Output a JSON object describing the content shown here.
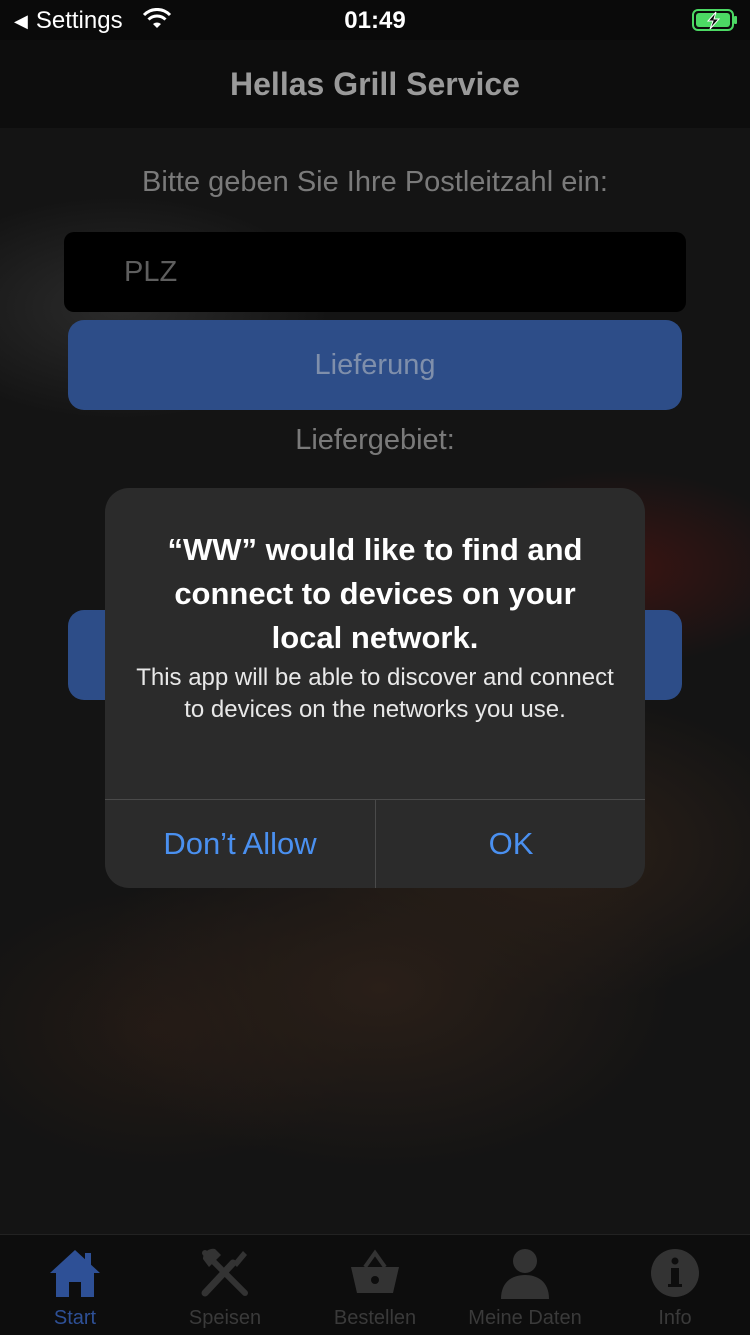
{
  "status_bar": {
    "back_label": "Settings",
    "time": "01:49"
  },
  "nav": {
    "title": "Hellas Grill Service"
  },
  "main": {
    "prompt": "Bitte geben Sie Ihre Postleitzahl ein:",
    "plz_placeholder": "PLZ",
    "delivery_button": "Lieferung",
    "delivery_area_label": "Liefergebiet:"
  },
  "alert": {
    "title": "“WW” would like to find and connect to devices on your local network.",
    "message": "This app will be able to discover and connect to devices on the networks you use.",
    "deny_label": "Don’t Allow",
    "ok_label": "OK",
    "button_color": "#4a90f0"
  },
  "tabs": [
    {
      "label": "Start",
      "icon": "home-icon",
      "active": true
    },
    {
      "label": "Speisen",
      "icon": "fork-knife-icon",
      "active": false
    },
    {
      "label": "Bestellen",
      "icon": "basket-icon",
      "active": false
    },
    {
      "label": "Meine Daten",
      "icon": "person-icon",
      "active": false
    },
    {
      "label": "Info",
      "icon": "info-icon",
      "active": false
    }
  ],
  "colors": {
    "accent": "#2e5096",
    "battery": "#4cd964"
  }
}
